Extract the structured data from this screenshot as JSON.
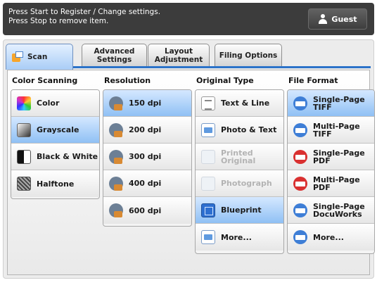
{
  "message_bar": {
    "line1": "Press Start to Register / Change settings.",
    "line2": "Press Stop to remove item."
  },
  "user": {
    "label": "Guest",
    "icon": "user-icon"
  },
  "tabs": [
    {
      "label": "Scan",
      "active": true,
      "icon": "scan-icon"
    },
    {
      "label_line1": "Advanced",
      "label_line2": "Settings"
    },
    {
      "label_line1": "Layout",
      "label_line2": "Adjustment"
    },
    {
      "label": "Filing Options"
    }
  ],
  "columns": {
    "color_scanning": {
      "heading": "Color Scanning",
      "options": [
        {
          "label": "Color",
          "icon": "color-icon",
          "selected": false
        },
        {
          "label": "Grayscale",
          "icon": "grayscale-icon",
          "selected": true
        },
        {
          "label": "Black & White",
          "icon": "black-white-icon",
          "selected": false
        },
        {
          "label": "Halftone",
          "icon": "halftone-icon",
          "selected": false
        }
      ]
    },
    "resolution": {
      "heading": "Resolution",
      "options": [
        {
          "label": "150 dpi",
          "selected": true
        },
        {
          "label": "200 dpi",
          "selected": false
        },
        {
          "label": "300 dpi",
          "selected": false
        },
        {
          "label": "400 dpi",
          "selected": false
        },
        {
          "label": "600 dpi",
          "selected": false
        }
      ]
    },
    "original_type": {
      "heading": "Original Type",
      "options": [
        {
          "label": "Text & Line",
          "selected": false,
          "enabled": true
        },
        {
          "label": "Photo & Text",
          "selected": false,
          "enabled": true
        },
        {
          "label": "Printed Original",
          "selected": false,
          "enabled": false
        },
        {
          "label": "Photograph",
          "selected": false,
          "enabled": false
        },
        {
          "label": "Blueprint",
          "selected": true,
          "enabled": true
        },
        {
          "label": "More...",
          "selected": false,
          "enabled": true
        }
      ]
    },
    "file_format": {
      "heading": "File Format",
      "options": [
        {
          "line1": "Single-Page",
          "line2": "TIFF",
          "badge": "TIFF",
          "selected": true
        },
        {
          "line1": "Multi-Page",
          "line2": "TIFF",
          "badge": "TIFF",
          "selected": false
        },
        {
          "line1": "Single-Page",
          "line2": "PDF",
          "badge": "PDF",
          "selected": false
        },
        {
          "line1": "Multi-Page",
          "line2": "PDF",
          "badge": "PDF",
          "selected": false
        },
        {
          "line1": "Single-Page",
          "line2": "DocuWorks",
          "badge": "DW",
          "selected": false
        },
        {
          "label": "More...",
          "selected": false
        }
      ]
    }
  },
  "colors": {
    "selected_top": "#d5e8ff",
    "selected_bottom": "#8fc0f4",
    "tab_accent": "#2c73c9",
    "message_bar": "#3c3c3c"
  }
}
